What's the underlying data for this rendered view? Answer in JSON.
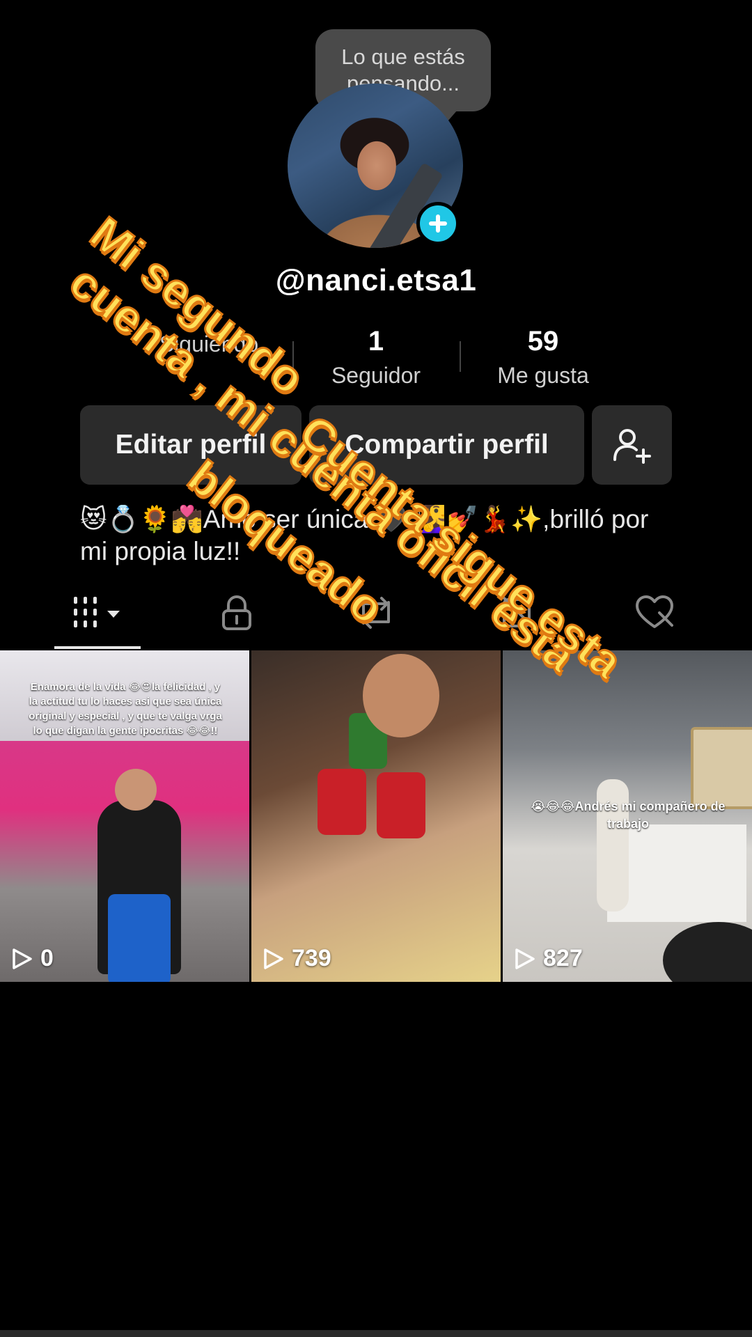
{
  "profile": {
    "tooltip_line1": "Lo que estás",
    "tooltip_line2": "pensando...",
    "username": "@nanci.etsa1",
    "bio": "😻💍🌻💏Amo ser única 🖤 🧏‍♀️💅💃✨,brilló por mi propia luz!!"
  },
  "stats": [
    {
      "value": "",
      "label": "Siguiendo"
    },
    {
      "value": "1",
      "label": "Seguidor"
    },
    {
      "value": "59",
      "label": "Me gusta"
    }
  ],
  "buttons": {
    "edit_profile": "Editar perfil",
    "share_profile": "Compartir perfil"
  },
  "tabs": [
    "videos-grid",
    "private",
    "reposts",
    "hidden",
    "liked"
  ],
  "videos": [
    {
      "views": "0",
      "caption": "Enamora de la vida 😂😍la felicidad , y la actitud tu lo haces asi que sea única original y especial , y que te valga vrga lo que digan la gente ipocritas 😂😂!!"
    },
    {
      "views": "739",
      "caption": ""
    },
    {
      "views": "827",
      "caption": "😭😂😂Andrés mi compañero de trabajo"
    }
  ],
  "overlay": {
    "line1": "Mi segundo",
    "line2": "cuenta , mi cuenta oficil esta",
    "line3": "bloqueado",
    "line4": "Cuenta sigue esta"
  },
  "colors": {
    "accent_add": "#20c7e6",
    "overlay_text": "#ffe15a",
    "overlay_stroke": "#e07a12"
  }
}
